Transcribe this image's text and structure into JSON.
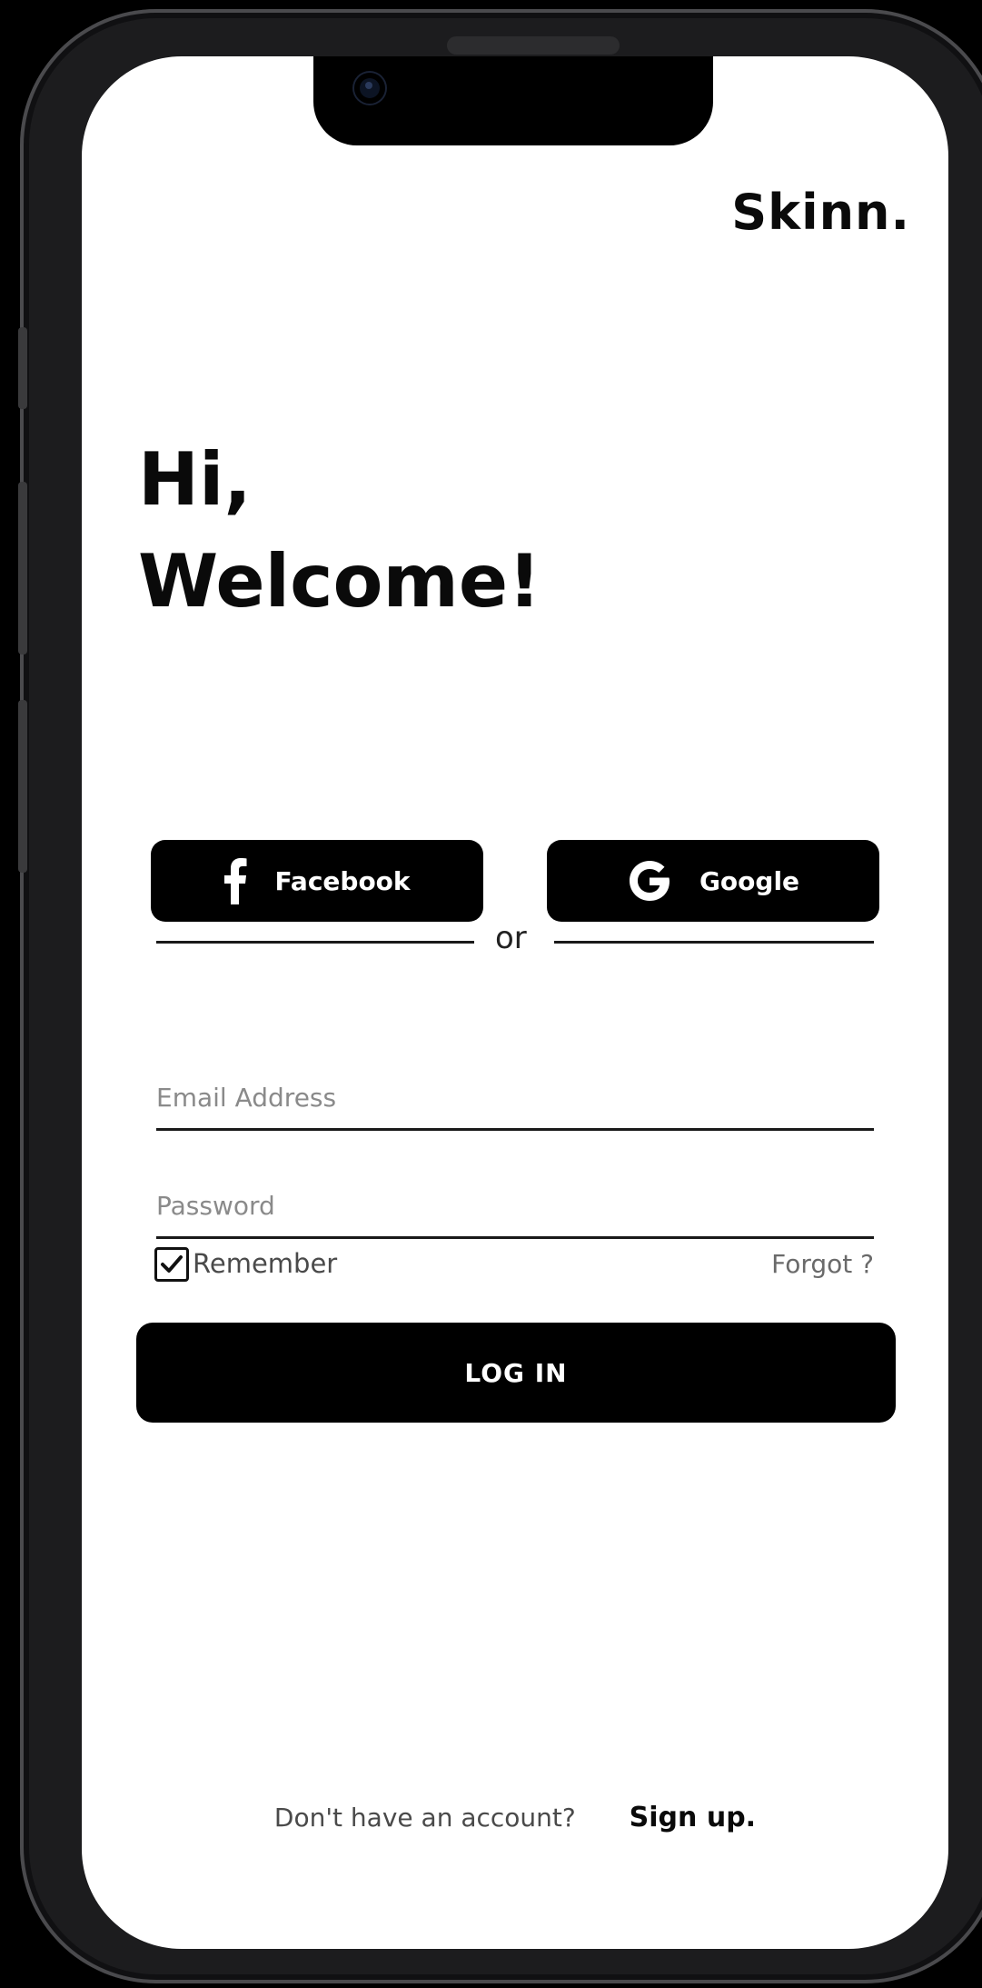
{
  "app": {
    "brand": "Skinn."
  },
  "greeting": {
    "line1": "Hi,",
    "line2": "Welcome!"
  },
  "social": {
    "facebook_label": "Facebook",
    "google_label": "Google",
    "divider_text": "or"
  },
  "form": {
    "email_placeholder": "Email Address",
    "email_value": "",
    "password_placeholder": "Password",
    "password_value": "",
    "remember_label": "Remember",
    "remember_checked": true,
    "forgot_label": "Forgot ?",
    "login_label": "LOG IN"
  },
  "footer": {
    "prompt": "Don't have an account?",
    "signup_label": "Sign up."
  },
  "colors": {
    "primary": "#000000",
    "background": "#ffffff",
    "text": "#0a0a0a",
    "muted": "#8a8a8a"
  },
  "icons": {
    "facebook": "facebook-icon",
    "google": "google-icon",
    "checkbox": "check-icon"
  }
}
